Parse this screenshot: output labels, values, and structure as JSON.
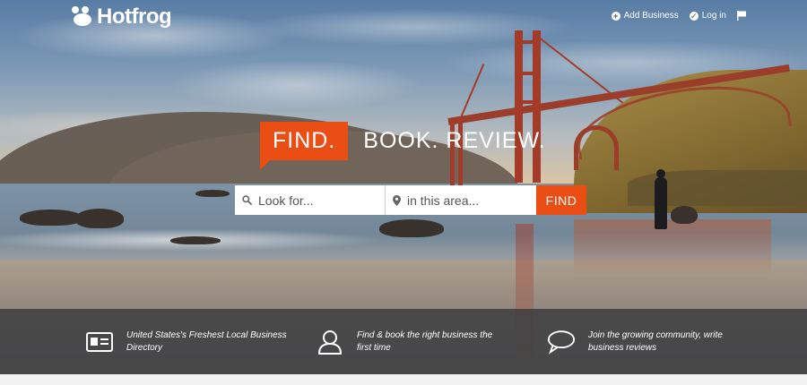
{
  "header": {
    "logo_text": "Hotfrog",
    "nav": [
      {
        "label": "Add Business",
        "icon": "plus-circle-icon"
      },
      {
        "label": "Log in",
        "icon": "check-circle-icon"
      },
      {
        "label": "",
        "icon": "flag-icon"
      }
    ]
  },
  "tagline": {
    "find": "FIND.",
    "rest": "BOOK. REVIEW."
  },
  "search": {
    "what_placeholder": "Look for...",
    "where_placeholder": "in this area...",
    "button": "FIND"
  },
  "features": [
    {
      "icon": "id-card-icon",
      "text": "United States's Freshest Local Business Directory"
    },
    {
      "icon": "user-icon",
      "text": "Find & book the right business the first time"
    },
    {
      "icon": "speech-bubble-icon",
      "text": "Join the growing community, write business reviews"
    }
  ],
  "colors": {
    "accent": "#ea4e15",
    "band": "#37373a"
  }
}
